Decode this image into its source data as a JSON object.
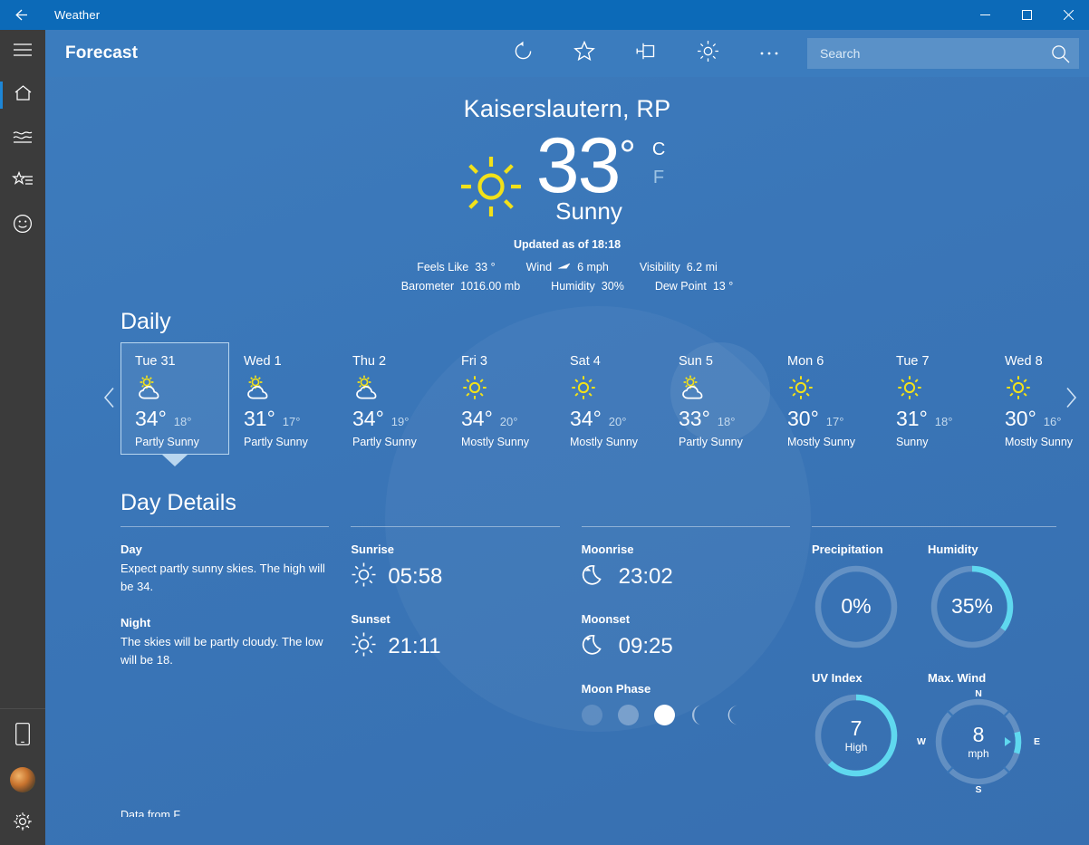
{
  "window": {
    "title": "Weather",
    "back_icon": "back-arrow-icon",
    "minimize_label": "Minimize",
    "maximize_label": "Maximize",
    "close_label": "Close"
  },
  "command_bar": {
    "title": "Forecast",
    "buttons": [
      {
        "name": "refresh",
        "icon": "refresh-icon",
        "label": "Refresh"
      },
      {
        "name": "favorite",
        "icon": "star-icon",
        "label": "Add to Favorites"
      },
      {
        "name": "pin",
        "icon": "pin-icon",
        "label": "Pin to Start"
      },
      {
        "name": "theme",
        "icon": "sun-icon",
        "label": "Change Background"
      },
      {
        "name": "more",
        "icon": "ellipsis-icon",
        "label": "See more"
      }
    ],
    "search": {
      "placeholder": "Search",
      "value": "",
      "icon": "search-icon"
    }
  },
  "sidebar": {
    "items": [
      {
        "name": "hamburger",
        "icon": "hamburger-icon",
        "label": "Navigation",
        "active": false
      },
      {
        "name": "forecast",
        "icon": "home-icon",
        "label": "Forecast",
        "active": true
      },
      {
        "name": "maps",
        "icon": "chart-icon",
        "label": "Maps",
        "active": false
      },
      {
        "name": "favorites",
        "icon": "star-list-icon",
        "label": "Favorites",
        "active": false
      },
      {
        "name": "news",
        "icon": "smiley-icon",
        "label": "News",
        "active": false
      }
    ],
    "bottom_items": [
      {
        "name": "send-to-phone",
        "icon": "phone-icon",
        "label": "Send to phone"
      },
      {
        "name": "account",
        "icon": "avatar-icon",
        "label": "Account"
      },
      {
        "name": "settings",
        "icon": "gear-icon",
        "label": "Settings"
      }
    ]
  },
  "current": {
    "location": "Kaiserslautern, RP",
    "icon": "sunny-icon",
    "temperature": "33",
    "degree": "°",
    "unit_celsius": "C",
    "unit_fahrenheit": "F",
    "selected_unit": "C",
    "condition": "Sunny",
    "updated": "Updated as of 18:18",
    "stats_row1": [
      {
        "label": "Feels Like",
        "value": "33 °"
      },
      {
        "label": "Wind",
        "value": "6 mph",
        "icon": "wind-arrow-icon"
      },
      {
        "label": "Visibility",
        "value": "6.2 mi"
      }
    ],
    "stats_row2": [
      {
        "label": "Barometer",
        "value": "1016.00 mb"
      },
      {
        "label": "Humidity",
        "value": "30%"
      },
      {
        "label": "Dew Point",
        "value": "13 °"
      }
    ]
  },
  "daily": {
    "heading": "Daily",
    "prev_icon": "chevron-left-icon",
    "next_icon": "chevron-right-icon",
    "cards": [
      {
        "day": "Tue 31",
        "icon": "partly-sunny-icon",
        "high": "34°",
        "low": "18°",
        "condition": "Partly Sunny",
        "selected": true
      },
      {
        "day": "Wed 1",
        "icon": "partly-sunny-icon",
        "high": "31°",
        "low": "17°",
        "condition": "Partly Sunny",
        "selected": false
      },
      {
        "day": "Thu 2",
        "icon": "partly-sunny-icon",
        "high": "34°",
        "low": "19°",
        "condition": "Partly Sunny",
        "selected": false
      },
      {
        "day": "Fri 3",
        "icon": "sunny-icon",
        "high": "34°",
        "low": "20°",
        "condition": "Mostly Sunny",
        "selected": false
      },
      {
        "day": "Sat 4",
        "icon": "sunny-icon",
        "high": "34°",
        "low": "20°",
        "condition": "Mostly Sunny",
        "selected": false
      },
      {
        "day": "Sun 5",
        "icon": "partly-sunny-icon",
        "high": "33°",
        "low": "18°",
        "condition": "Partly Sunny",
        "selected": false
      },
      {
        "day": "Mon 6",
        "icon": "sunny-icon",
        "high": "30°",
        "low": "17°",
        "condition": "Mostly Sunny",
        "selected": false
      },
      {
        "day": "Tue 7",
        "icon": "sunny-icon",
        "high": "31°",
        "low": "18°",
        "condition": "Sunny",
        "selected": false
      },
      {
        "day": "Wed 8",
        "icon": "sunny-icon",
        "high": "30°",
        "low": "16°",
        "condition": "Mostly Sunny",
        "selected": false
      }
    ]
  },
  "day_details": {
    "heading": "Day Details",
    "day": {
      "label": "Day",
      "text": "Expect partly sunny skies. The high will be 34."
    },
    "night": {
      "label": "Night",
      "text": "The skies will be partly cloudy. The low will be 18."
    },
    "sunrise": {
      "label": "Sunrise",
      "value": "05:58",
      "icon": "sunrise-icon"
    },
    "sunset": {
      "label": "Sunset",
      "value": "21:11",
      "icon": "sunset-icon"
    },
    "moonrise": {
      "label": "Moonrise",
      "value": "23:02",
      "icon": "moonrise-icon"
    },
    "moonset": {
      "label": "Moonset",
      "value": "09:25",
      "icon": "moonset-icon"
    },
    "moon_phase": {
      "label": "Moon Phase",
      "phases": [
        {
          "name": "new-moon",
          "active": false
        },
        {
          "name": "first-quarter",
          "active": false
        },
        {
          "name": "full-moon",
          "active": true
        },
        {
          "name": "last-quarter",
          "active": false
        },
        {
          "name": "waning-crescent",
          "active": false
        }
      ]
    },
    "gauges": [
      {
        "name": "precipitation",
        "title": "Precipitation",
        "value": "0%",
        "sub": "",
        "percent": 0
      },
      {
        "name": "humidity",
        "title": "Humidity",
        "value": "35%",
        "sub": "",
        "percent": 35
      },
      {
        "name": "uv-index",
        "title": "UV Index",
        "value": "7",
        "sub": "High",
        "percent": 62
      },
      {
        "name": "max-wind",
        "title": "Max. Wind",
        "value": "8",
        "sub": "mph",
        "percent": 0,
        "compass": {
          "n": "N",
          "e": "E",
          "s": "S",
          "w": "W",
          "direction": "E"
        }
      }
    ]
  },
  "footnote": "Data from F",
  "colors": {
    "accent_cyan": "#5fd8ef",
    "sun_yellow": "#f2e119",
    "background_blue": "#3a76b8",
    "titlebar_blue": "#0c6ab8",
    "sidebar_gray": "#3b3b3b"
  }
}
